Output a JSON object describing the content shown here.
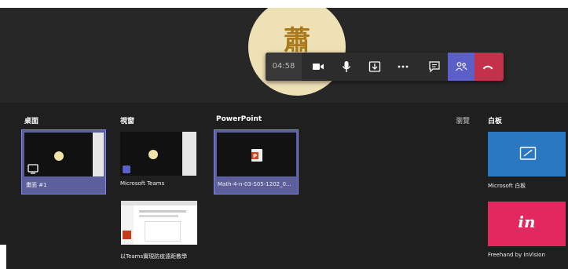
{
  "call": {
    "avatar_glyph": "蕭",
    "timer": "04:58",
    "controls": [
      {
        "name": "camera",
        "icon": "camera-icon"
      },
      {
        "name": "microphone",
        "icon": "microphone-icon"
      },
      {
        "name": "share",
        "icon": "share-tray-icon"
      },
      {
        "name": "more",
        "icon": "more-options-icon"
      },
      {
        "name": "chat",
        "icon": "chat-icon"
      },
      {
        "name": "participants",
        "icon": "participants-icon"
      },
      {
        "name": "hangup",
        "icon": "hang-up-icon"
      }
    ],
    "colors": {
      "active": "#5b5fc7",
      "hangup": "#c4314b",
      "avatar_bg": "#efe1b6",
      "avatar_text": "#a9791b"
    }
  },
  "share": {
    "sections": {
      "desktop": "桌面",
      "window": "視窗",
      "powerpoint": "PowerPoint",
      "browse": "瀏覽",
      "whiteboard": "白板"
    },
    "desktop_items": [
      {
        "caption": "畫面 #1",
        "selected": true
      }
    ],
    "window_items": [
      {
        "caption": "Microsoft Teams"
      },
      {
        "caption": "以Teams實現防疫遠距教學"
      }
    ],
    "powerpoint_items": [
      {
        "caption": "Math-4-n-03-S05-1202_0...",
        "selected": true
      }
    ],
    "whiteboard_items": [
      {
        "caption": "Microsoft 白板",
        "icon": "whiteboard-icon",
        "color": "#2b78c2"
      },
      {
        "caption": "Freehand by InVision",
        "icon": "invision-logo",
        "logo_text": "in",
        "color": "#e2285f"
      }
    ]
  }
}
